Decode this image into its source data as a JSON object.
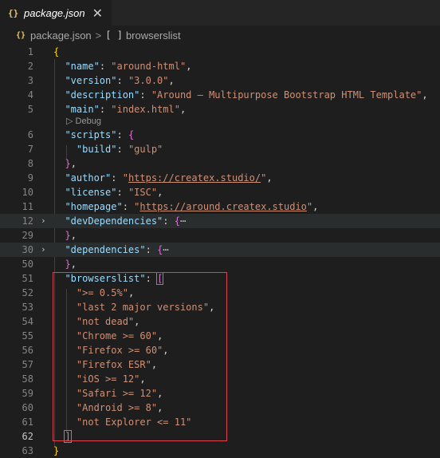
{
  "tab": {
    "icon": "{}",
    "title": "package.json",
    "close": "✕"
  },
  "breadcrumb": {
    "icon": "{}",
    "file": "package.json",
    "separator": ">",
    "array_icon": "[ ]",
    "item": "browserslist"
  },
  "codelens": "▷ Debug",
  "lines": [
    {
      "num": "1"
    },
    {
      "num": "2"
    },
    {
      "num": "3"
    },
    {
      "num": "4"
    },
    {
      "num": "5"
    },
    {
      "num": "6"
    },
    {
      "num": "7"
    },
    {
      "num": "8"
    },
    {
      "num": "9"
    },
    {
      "num": "10"
    },
    {
      "num": "11"
    },
    {
      "num": "12"
    },
    {
      "num": "29"
    },
    {
      "num": "30"
    },
    {
      "num": "50"
    },
    {
      "num": "51"
    },
    {
      "num": "52"
    },
    {
      "num": "53"
    },
    {
      "num": "54"
    },
    {
      "num": "55"
    },
    {
      "num": "56"
    },
    {
      "num": "57"
    },
    {
      "num": "58"
    },
    {
      "num": "59"
    },
    {
      "num": "60"
    },
    {
      "num": "61"
    },
    {
      "num": "62"
    },
    {
      "num": "63"
    }
  ],
  "code": {
    "name_key": "\"name\"",
    "name_val": "\"around-html\"",
    "version_key": "\"version\"",
    "version_val": "\"3.0.0\"",
    "description_key": "\"description\"",
    "description_val": "\"Around – Multipurpose Bootstrap HTML Template\"",
    "main_key": "\"main\"",
    "main_val": "\"index.html\"",
    "scripts_key": "\"scripts\"",
    "build_key": "\"build\"",
    "build_val": "\"gulp\"",
    "author_key": "\"author\"",
    "author_q1": "\"",
    "author_url": "https://createx.studio/",
    "author_q2": "\"",
    "license_key": "\"license\"",
    "license_val": "\"ISC\"",
    "homepage_key": "\"homepage\"",
    "homepage_q1": "\"",
    "homepage_url": "https://around.createx.studio",
    "homepage_q2": "\"",
    "devdeps_key": "\"devDependencies\"",
    "deps_key": "\"dependencies\"",
    "browserslist_key": "\"browserslist\"",
    "ellipsis": "⋯",
    "browsers": [
      "\">= 0.5%\"",
      "\"last 2 major versions\"",
      "\"not dead\"",
      "\"Chrome >= 60\"",
      "\"Firefox >= 60\"",
      "\"Firefox ESR\"",
      "\"iOS >= 12\"",
      "\"Safari >= 12\"",
      "\"Android >= 8\"",
      "\"not Explorer <= 11\""
    ]
  }
}
